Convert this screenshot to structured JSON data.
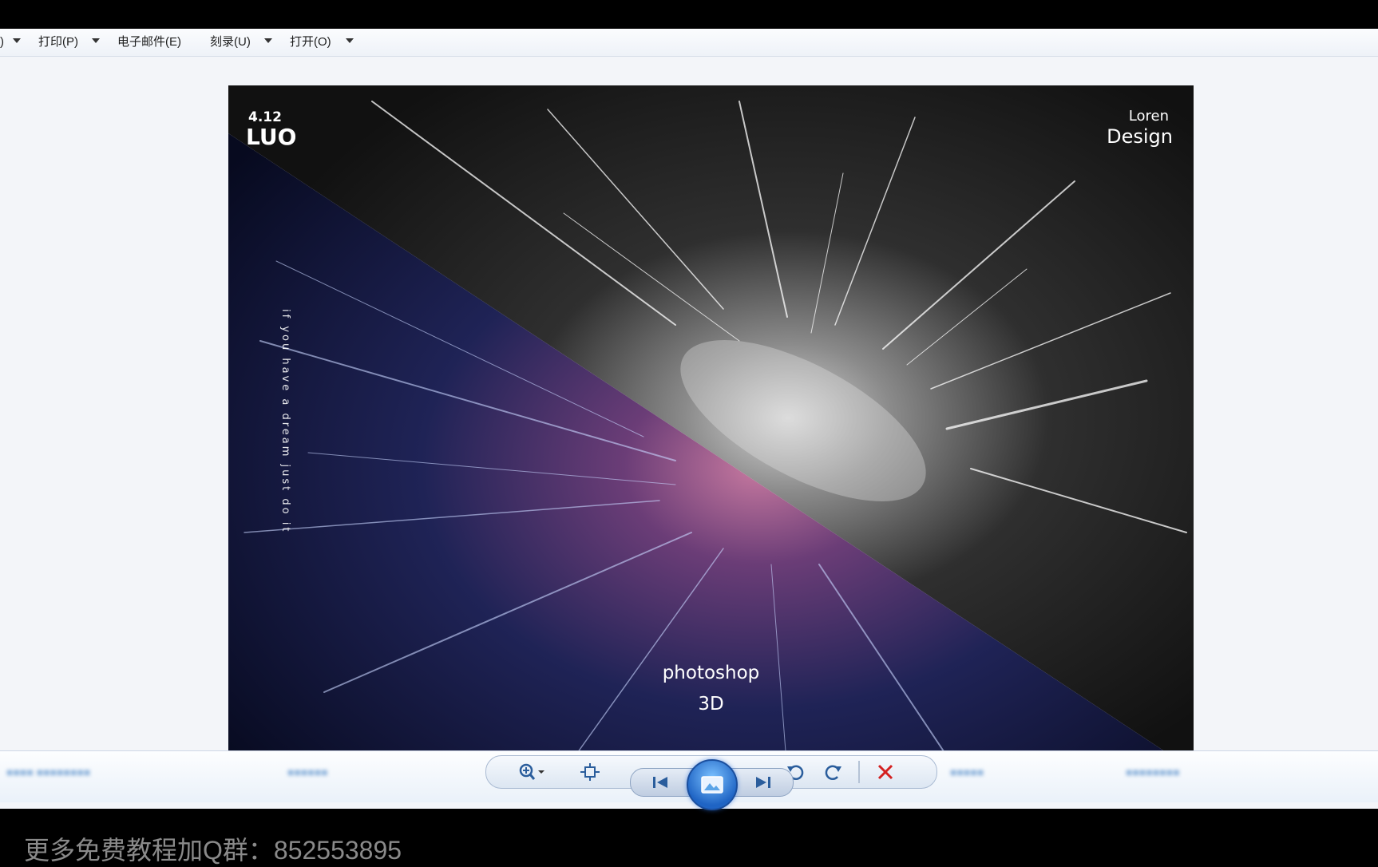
{
  "menubar": {
    "items": [
      {
        "label": ")"
      },
      {
        "label": "打印(P)"
      },
      {
        "label": "电子邮件(E)"
      },
      {
        "label": "刻录(U)"
      },
      {
        "label": "打开(O)"
      }
    ]
  },
  "photo": {
    "date": "4.12",
    "brand": "LUO",
    "author_line1": "Loren",
    "author_line2": "Design",
    "vertical_text": "if you have a dream just do it",
    "title": "photoshop",
    "subtitle": "3D"
  },
  "controls": {
    "icons": [
      "zoom-icon",
      "fit-window-icon",
      "previous-icon",
      "slideshow-icon",
      "next-icon",
      "rotate-left-icon",
      "rotate-right-icon",
      "delete-icon"
    ],
    "delete_color": "#d42020",
    "accent_color": "#2d7fd8"
  },
  "caption": "更多免费教程加Q群：852553895"
}
